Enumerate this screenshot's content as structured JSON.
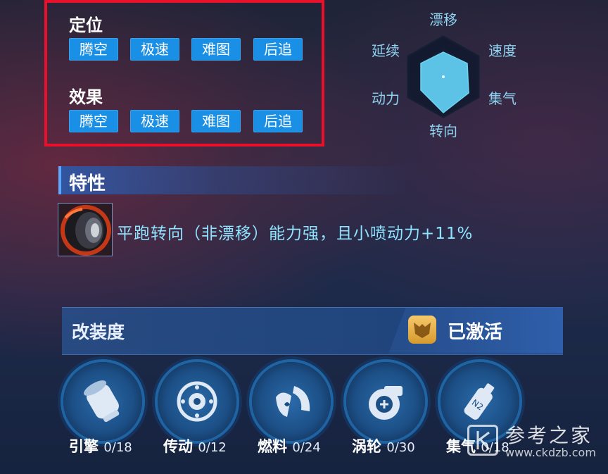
{
  "positioning": {
    "title": "定位",
    "tags": [
      "腾空",
      "极速",
      "难图",
      "后追"
    ]
  },
  "effect": {
    "title": "效果",
    "tags": [
      "腾空",
      "极速",
      "难图",
      "后追"
    ]
  },
  "radar": {
    "labels": {
      "top": "漂移",
      "top_left": "延续",
      "top_right": "速度",
      "bottom_left": "动力",
      "bottom_right": "集气",
      "bottom": "转向"
    }
  },
  "trait": {
    "title": "特性",
    "description": "平跑转向（非漂移）能力强，且小喷动力+11%",
    "icon": "tire-icon"
  },
  "modification": {
    "title": "改装度",
    "status": "已激活",
    "status_icon": "mask-badge-icon",
    "parts": [
      {
        "name": "引擎",
        "count": "0/18",
        "icon": "engine-icon"
      },
      {
        "name": "传动",
        "count": "0/12",
        "icon": "gear-icon"
      },
      {
        "name": "燃料",
        "count": "0/24",
        "icon": "fuel-icon"
      },
      {
        "name": "涡轮",
        "count": "0/30",
        "icon": "turbo-icon"
      },
      {
        "name": "集气",
        "count": "0/18",
        "icon": "n2o-icon"
      }
    ]
  },
  "watermark": {
    "text": "参考之家",
    "url": "www.ckdzb.com"
  },
  "colors": {
    "highlight": "#e8102a",
    "tag_bg": "#1a8fe6",
    "trait_text": "#8ee3ff",
    "radar_label": "#8fd3f0"
  }
}
